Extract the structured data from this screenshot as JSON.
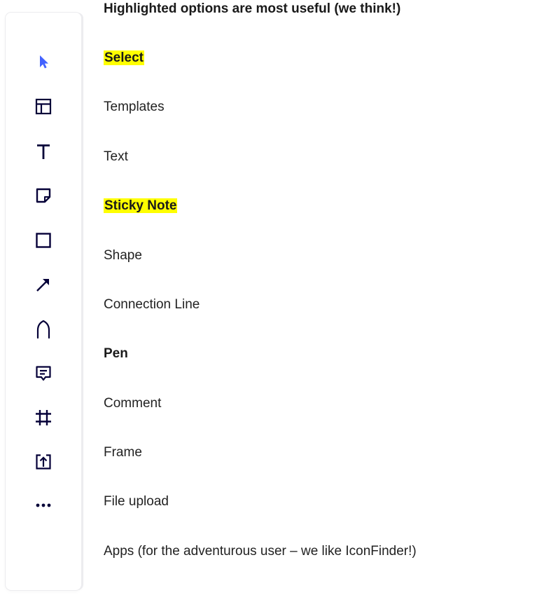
{
  "heading": "Highlighted options are most useful (we think!)",
  "colors": {
    "highlight": "#ffff00",
    "select_icon": "#4262ff",
    "icon": "#050038",
    "toolbar_border": "#ececef"
  },
  "tools": [
    {
      "id": "select",
      "icon": "cursor-arrow-icon",
      "label": "Select",
      "bold": true,
      "highlighted": true
    },
    {
      "id": "templates",
      "icon": "templates-icon",
      "label": "Templates",
      "bold": false,
      "highlighted": false
    },
    {
      "id": "text",
      "icon": "text-icon",
      "label": "Text",
      "bold": false,
      "highlighted": false
    },
    {
      "id": "sticky-note",
      "icon": "sticky-note-icon",
      "label": "Sticky Note",
      "bold": true,
      "highlighted": true
    },
    {
      "id": "shape",
      "icon": "square-shape-icon",
      "label": "Shape",
      "bold": false,
      "highlighted": false
    },
    {
      "id": "connection-line",
      "icon": "arrow-line-icon",
      "label": "Connection Line",
      "bold": false,
      "highlighted": false
    },
    {
      "id": "pen",
      "icon": "pen-icon",
      "label": "Pen",
      "bold": true,
      "highlighted": false
    },
    {
      "id": "comment",
      "icon": "comment-icon",
      "label": "Comment",
      "bold": false,
      "highlighted": false
    },
    {
      "id": "frame",
      "icon": "frame-icon",
      "label": "Frame",
      "bold": false,
      "highlighted": false
    },
    {
      "id": "file-upload",
      "icon": "upload-icon",
      "label": "File upload",
      "bold": false,
      "highlighted": false
    },
    {
      "id": "apps",
      "icon": "more-dots-icon",
      "label": "Apps (for the adventurous user – we like IconFinder!)",
      "bold": false,
      "highlighted": false
    }
  ]
}
